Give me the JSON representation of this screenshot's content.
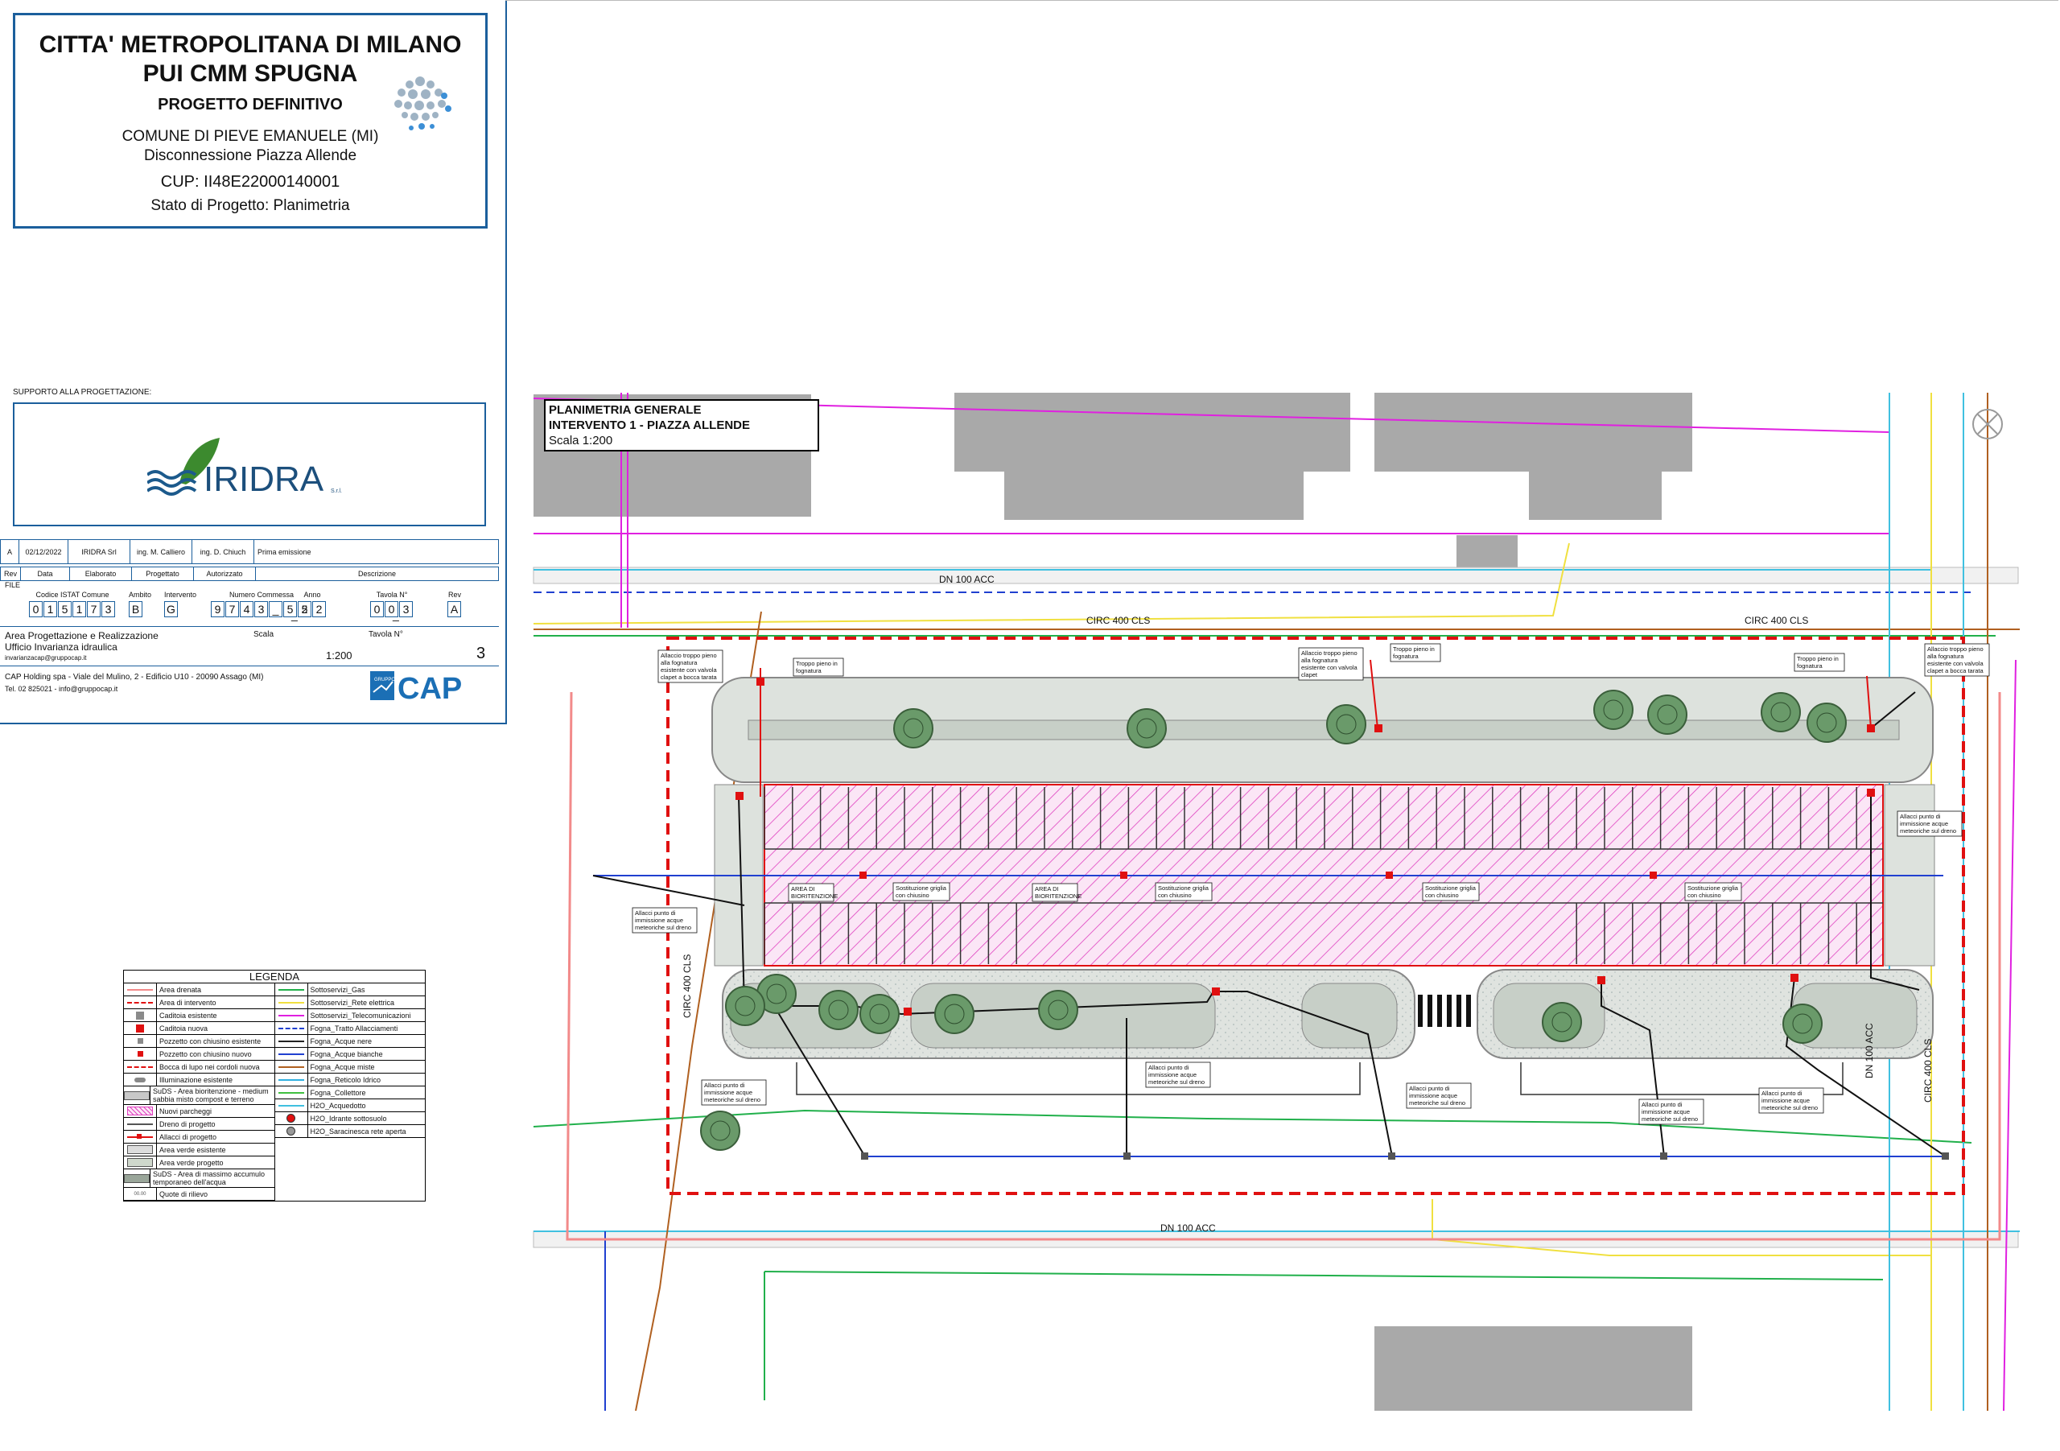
{
  "header": {
    "org": "CITTA' METROPOLITANA DI MILANO",
    "project": "PUI CMM SPUGNA",
    "phase": "PROGETTO DEFINITIVO",
    "comune": "COMUNE DI PIEVE EMANUELE (MI)",
    "subject": "Disconnessione Piazza Allende",
    "cup": "CUP: II48E22000140001",
    "stato": "Stato di Progetto: Planimetria"
  },
  "support": {
    "label": "SUPPORTO ALLA PROGETTAZIONE:",
    "logo_text": "IRIDRA",
    "logo_suffix": "S.r.l."
  },
  "revision": {
    "row": [
      "A",
      "02/12/2022",
      "IRIDRA Srl",
      "ing. M. Calliero",
      "ing. D. Chiuch",
      "Prima emissione"
    ],
    "headers": [
      "Rev",
      "Data",
      "Elaborato",
      "Progettato",
      "Autorizzato",
      "Descrizione"
    ]
  },
  "file_code": {
    "label": "FILE",
    "fields": [
      {
        "label": "Codice ISTAT Comune",
        "chars": [
          "0",
          "1",
          "5",
          "1",
          "7",
          "3"
        ]
      },
      {
        "label": "Ambito",
        "chars": [
          "B"
        ]
      },
      {
        "label": "Intervento",
        "chars": [
          "G"
        ]
      },
      {
        "label": "Numero Commessa",
        "chars": [
          "9",
          "7",
          "4",
          "3",
          "_",
          "5",
          "5"
        ]
      },
      {
        "label": "Anno",
        "chars": [
          "2",
          "2"
        ]
      },
      {
        "label": "Tavola N°",
        "chars": [
          "0",
          "0",
          "3"
        ]
      },
      {
        "label": "Rev",
        "chars": [
          "A"
        ]
      }
    ],
    "separator": "_"
  },
  "area": {
    "line1": "Area Progettazione e Realizzazione",
    "line2": "Ufficio Invarianza idraulica",
    "email": "invarianzacap@gruppocap.it",
    "scala_label": "Scala",
    "scala_value": "1:200",
    "tavola_label": "Tavola N°",
    "tavola_value": "3"
  },
  "company": {
    "address": "CAP Holding spa - Viale del Mulino, 2 - Edificio U10 - 20090 Assago (MI)",
    "contact": "Tel. 02 825021 - info@gruppocap.it",
    "logo_text": "CAP",
    "logo_small": "GRUPPO"
  },
  "plan": {
    "title1": "PLANIMETRIA GENERALE",
    "title2": "INTERVENTO 1 - PIAZZA ALLENDE",
    "scale": "Scala 1:200",
    "labels": {
      "dn_top": "DN 100 ACC",
      "dn_bottom": "DN 100 ACC",
      "circ_top_left": "CIRC 400 CLS",
      "circ_top_right": "CIRC 400 CLS",
      "circ_left": "CIRC 400 CLS",
      "circ_right": "CIRC 400 CLS",
      "dn_right": "DN 100 ACC"
    },
    "notes": {
      "n1": [
        "Allaccio troppo pieno",
        "alla fognatura",
        "esistente con valvola",
        "clapet a bocca tarata"
      ],
      "n2": [
        "Troppo pieno in",
        "fognatura"
      ],
      "n3": [
        "Allaccio troppo pieno",
        "alla fognatura",
        "esistente con valvola",
        "clapet"
      ],
      "n4": [
        "Troppo pieno in",
        "fognatura"
      ],
      "n5": [
        "Troppo pieno in",
        "fognatura"
      ],
      "n6": [
        "Allaccio troppo pieno",
        "alla fognatura",
        "esistente con valvola",
        "clapet a bocca tarata"
      ],
      "n7": [
        "Allacci punto di",
        "immissione acque",
        "meteoriche sul dreno"
      ],
      "n8": [
        "Allacci punto di",
        "immissione acque",
        "meteoriche sul dreno"
      ],
      "bio1": [
        "AREA DI",
        "BIORITENZIONE"
      ],
      "bio2": [
        "AREA DI",
        "BIORITENZIONE"
      ],
      "sg1": [
        "Sostituzione griglia",
        "con chiusino"
      ],
      "sg2": [
        "Sostituzione griglia",
        "con chiusino"
      ],
      "sg3": [
        "Sostituzione griglia",
        "con chiusino"
      ],
      "sg4": [
        "Sostituzione griglia",
        "con chiusino"
      ],
      "a1": [
        "Allacci punto di",
        "immissione acque",
        "meteoriche sul dreno"
      ],
      "a2": [
        "Allacci punto di",
        "immissione acque",
        "meteoriche sul dreno"
      ],
      "a3": [
        "Allacci punto di",
        "immissione acque",
        "meteoriche sul dreno"
      ],
      "a4": [
        "Allacci punto di",
        "immissione acque",
        "meteoriche sul dreno"
      ],
      "a5": [
        "Allacci punto di",
        "immissione acque",
        "meteoriche sul dreno"
      ]
    }
  },
  "legend": {
    "title": "LEGENDA",
    "left": [
      {
        "label": "Area drenata",
        "sym": "line",
        "color": "#f28a8a"
      },
      {
        "label": "Area di intervento",
        "sym": "dash",
        "color": "#e01010"
      },
      {
        "label": "Caditoia esistente",
        "sym": "sq",
        "color": "#8a8a8a"
      },
      {
        "label": "Caditoia nuova",
        "sym": "sq",
        "color": "#e01010"
      },
      {
        "label": "Pozzetto con chiusino esistente",
        "sym": "sqs",
        "color": "#8a8a8a"
      },
      {
        "label": "Pozzetto con chiusino nuovo",
        "sym": "sqs",
        "color": "#e01010"
      },
      {
        "label": "Bocca di lupo nei cordoli nuova",
        "sym": "dash",
        "color": "#e01010"
      },
      {
        "label": "Illuminazione esistente",
        "sym": "pill",
        "color": "#888888"
      },
      {
        "label": "SuDS - Area bioritenzione - medium sabbia misto compost e terreno",
        "sym": "fill",
        "color": "#c8c8c8"
      },
      {
        "label": "Nuovi parcheggi",
        "sym": "hatch",
        "color": "#e040c0"
      },
      {
        "label": "Dreno di progetto",
        "sym": "line",
        "color": "#555555"
      },
      {
        "label": "Allacci di progetto",
        "sym": "arrow",
        "color": "#e01010"
      },
      {
        "label": "Area verde esistente",
        "sym": "fill",
        "color": "#dddddd"
      },
      {
        "label": "Area verde progetto",
        "sym": "fill",
        "color": "#cfd8cc"
      },
      {
        "label": "SuDS - Area di massimo accumulo temporaneo dell'acqua",
        "sym": "fill",
        "color": "#9aa69a"
      },
      {
        "label": "Quote di rilievo",
        "sym": "text",
        "color": "#555555"
      }
    ],
    "right": [
      {
        "label": "Sottoservizi_Gas",
        "sym": "line",
        "color": "#21b04b"
      },
      {
        "label": "Sottoservizi_Rete elettrica",
        "sym": "line",
        "color": "#f0e040"
      },
      {
        "label": "Sottoservizi_Telecomunicazioni",
        "sym": "line",
        "color": "#e020e0"
      },
      {
        "label": "Fogna_Tratto Allacciamenti",
        "sym": "dash",
        "color": "#2040d0"
      },
      {
        "label": "Fogna_Acque nere",
        "sym": "line",
        "color": "#222222"
      },
      {
        "label": "Fogna_Acque bianche",
        "sym": "line",
        "color": "#2040d0"
      },
      {
        "label": "Fogna_Acque miste",
        "sym": "line",
        "color": "#b06020"
      },
      {
        "label": "Fogna_Reticolo Idrico",
        "sym": "line",
        "color": "#30b0e0"
      },
      {
        "label": "Fogna_Collettore",
        "sym": "line",
        "color": "#40c040"
      },
      {
        "label": "H2O_Acquedotto",
        "sym": "line",
        "color": "#40c0e0"
      },
      {
        "label": "H2O_Idrante sottosuolo",
        "sym": "dot",
        "color": "#e01010"
      },
      {
        "label": "H2O_Saracinesca rete aperta",
        "sym": "dot",
        "color": "#999999"
      }
    ]
  },
  "colors": {
    "frame": "#1b5f9c",
    "intervention": "#e01010",
    "hatch": "#e040c0",
    "gas": "#21b04b",
    "telecom": "#e020e0",
    "electric": "#f0e040",
    "water": "#40c0e0",
    "sewer_white": "#2040d0",
    "mixed": "#b06020"
  }
}
